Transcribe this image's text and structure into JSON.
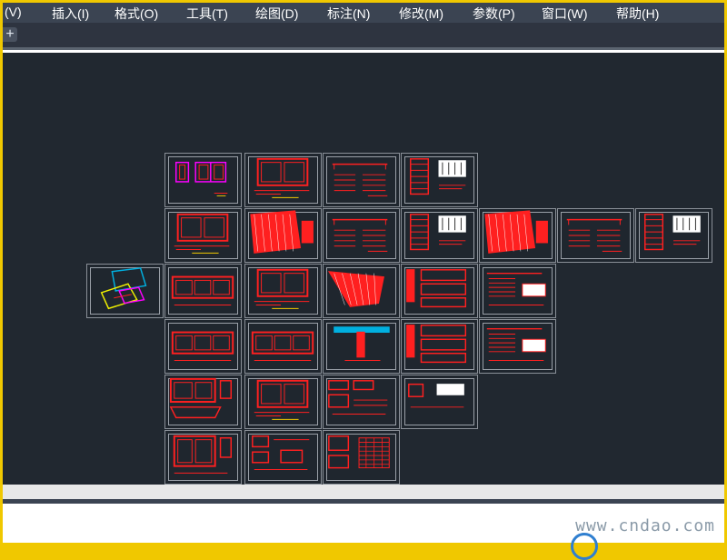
{
  "colors": {
    "frame": "#f0c800",
    "menubar_bg": "#3b4452",
    "canvas_bg": "#212830",
    "drawing_red": "#ff2020",
    "drawing_magenta": "#ff00ff",
    "drawing_cyan": "#00b0e0"
  },
  "menubar": {
    "items": [
      {
        "label": "(V)"
      },
      {
        "label": "插入(I)"
      },
      {
        "label": "格式(O)"
      },
      {
        "label": "工具(T)"
      },
      {
        "label": "绘图(D)"
      },
      {
        "label": "标注(N)"
      },
      {
        "label": "修改(M)"
      },
      {
        "label": "参数(P)"
      },
      {
        "label": "窗口(W)"
      },
      {
        "label": "帮助(H)"
      }
    ]
  },
  "tabstrip": {
    "add_icon": "+"
  },
  "watermark": {
    "text": "www.cndao.com"
  }
}
